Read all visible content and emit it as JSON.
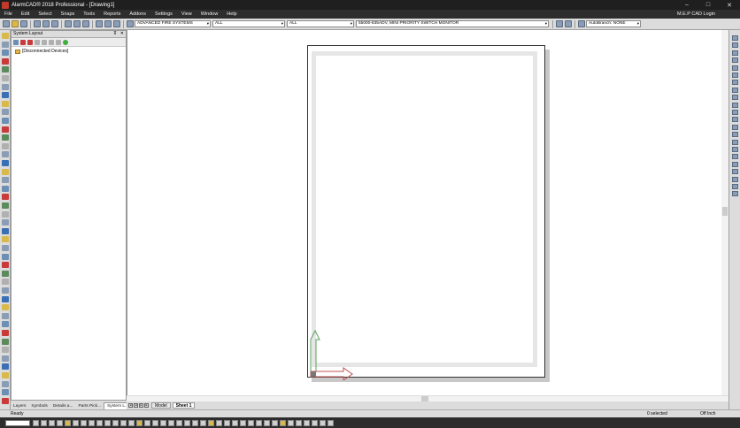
{
  "window": {
    "title": "AlarmCAD® 2018  Professional - [Drawing1]",
    "controls": {
      "minimize": "–",
      "maximize": "□",
      "close": "✕"
    }
  },
  "menu": {
    "items": [
      "File",
      "Edit",
      "Select",
      "Snaps",
      "Tools",
      "Reports",
      "Addons",
      "Settings",
      "View",
      "Window",
      "Help"
    ],
    "login": "M.E.P CAD Login"
  },
  "toolbar": {
    "manufacturer": "ADVANCED FIRE SYSTEMS",
    "filter1": "ALL",
    "filter2": "ALL",
    "device": "55000-835ADV, MINI PRIORITY SWITCH MONITOR",
    "autobranch": "AutoBranch: NONE",
    "dropdown_arrow": "▾"
  },
  "panel": {
    "title": "System Layout",
    "close": "✕",
    "pin": "⊼",
    "tree": [
      {
        "label": "[Disconnected Devices]"
      }
    ],
    "tabs": [
      "Layers",
      "Symbols",
      "Details a...",
      "Parts Pick...",
      "System L..."
    ]
  },
  "layout_tabs": {
    "nav": [
      "◂",
      "◂",
      "▸",
      "▸"
    ],
    "tabs": [
      "Model",
      "Sheet 1"
    ],
    "active": "Sheet 1"
  },
  "status": {
    "left": "Ready",
    "selected": "0 selected",
    "snap": "Off",
    "units": "Inch"
  },
  "colors": {
    "title_bg": "#1f1f1f",
    "menu_bg": "#2d2d2d",
    "toolbar_bg": "#dcdcdc",
    "ucs_y": "#5aa05a",
    "ucs_x": "#c05050"
  }
}
